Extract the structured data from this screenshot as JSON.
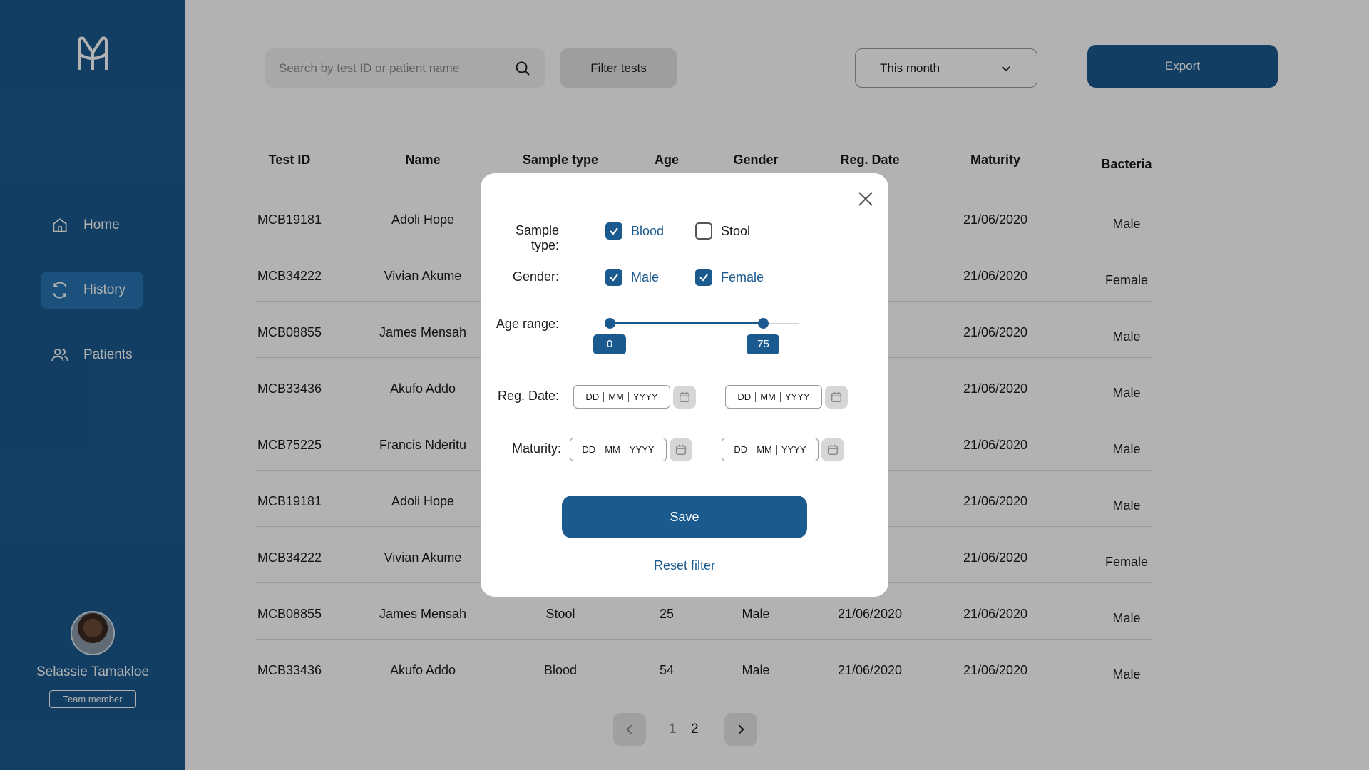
{
  "sidebar": {
    "nav": [
      {
        "label": "Home",
        "icon": "home-icon"
      },
      {
        "label": "History",
        "icon": "refresh-icon",
        "active": true
      },
      {
        "label": "Patients",
        "icon": "users-icon"
      }
    ],
    "user_name": "Selassie Tamakloe",
    "user_role": "Team member"
  },
  "toolbar": {
    "search_placeholder": "Search by test ID or patient name",
    "filter_label": "Filter tests",
    "period_value": "This month",
    "export_label": "Export"
  },
  "table": {
    "headers": [
      "Test ID",
      "Name",
      "Sample type",
      "Age",
      "Gender",
      "Reg. Date",
      "Maturity",
      "Bacteria"
    ],
    "rows": [
      [
        "MCB19181",
        "Adoli Hope",
        "",
        "",
        "",
        "20",
        "21/06/2020",
        "Male"
      ],
      [
        "MCB34222",
        "Vivian Akume",
        "",
        "",
        "",
        "20",
        "21/06/2020",
        "Female"
      ],
      [
        "MCB08855",
        "James Mensah",
        "",
        "",
        "",
        "20",
        "21/06/2020",
        "Male"
      ],
      [
        "MCB33436",
        "Akufo Addo",
        "",
        "",
        "",
        "20",
        "21/06/2020",
        "Male"
      ],
      [
        "MCB75225",
        "Francis Nderitu",
        "",
        "",
        "",
        "20",
        "21/06/2020",
        "Male"
      ],
      [
        "MCB19181",
        "Adoli Hope",
        "",
        "",
        "",
        "20",
        "21/06/2020",
        "Male"
      ],
      [
        "MCB34222",
        "Vivian Akume",
        "",
        "",
        "",
        "20",
        "21/06/2020",
        "Female"
      ],
      [
        "MCB08855",
        "James Mensah",
        "Stool",
        "25",
        "Male",
        "21/06/2020",
        "21/06/2020",
        "Male"
      ],
      [
        "MCB33436",
        "Akufo Addo",
        "Blood",
        "54",
        "Male",
        "21/06/2020",
        "21/06/2020",
        "Male"
      ]
    ]
  },
  "pagination": {
    "pages": [
      "1",
      "2"
    ],
    "current": "2"
  },
  "modal": {
    "sample_type_label": "Sample type:",
    "sample_options": [
      {
        "label": "Blood",
        "checked": true
      },
      {
        "label": "Stool",
        "checked": false
      }
    ],
    "gender_label": "Gender:",
    "gender_options": [
      {
        "label": "Male",
        "checked": true
      },
      {
        "label": "Female",
        "checked": true
      }
    ],
    "age_label": "Age range:",
    "age_min": "0",
    "age_max": "75",
    "age_range_fraction": {
      "min": 0.0,
      "max": 0.81
    },
    "reg_date_label": "Reg. Date:",
    "maturity_label": "Maturity:",
    "date_placeholder": {
      "dd": "DD",
      "mm": "MM",
      "yyyy": "YYYY"
    },
    "save_label": "Save",
    "reset_label": "Reset filter"
  },
  "colors": {
    "primary": "#1b5a8e",
    "overlay": "rgba(0,0,0,0.3)"
  }
}
